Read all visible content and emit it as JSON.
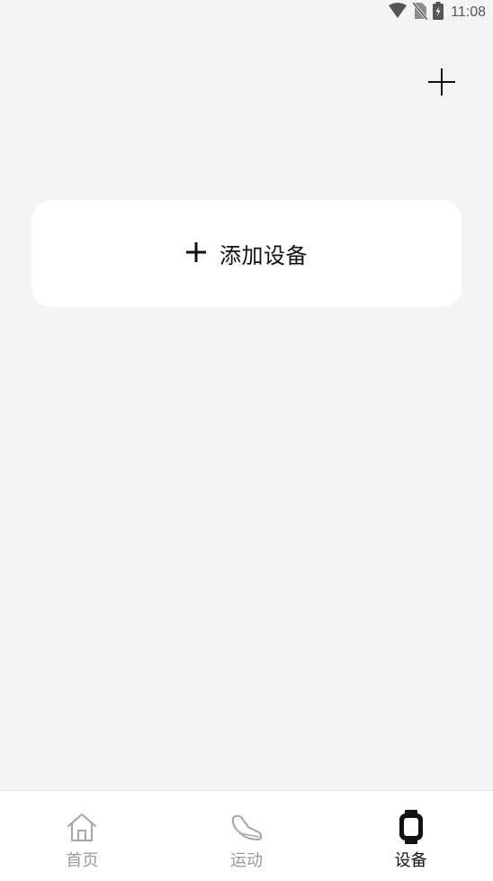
{
  "status_bar": {
    "time": "11:08",
    "icons": [
      "wifi-icon",
      "no-sim-icon",
      "battery-charging-icon"
    ]
  },
  "header": {
    "add_icon": "plus-icon"
  },
  "main": {
    "add_device": {
      "icon": "plus-icon",
      "label": "添加设备"
    }
  },
  "bottom_nav": {
    "active_index": 2,
    "items": [
      {
        "label": "首页",
        "icon": "home-icon"
      },
      {
        "label": "运动",
        "icon": "shoe-icon"
      },
      {
        "label": "设备",
        "icon": "watch-icon"
      }
    ]
  },
  "colors": {
    "background": "#f4f4f4",
    "card": "#ffffff",
    "active_text": "#111111",
    "inactive_text": "#9a9a9a"
  }
}
